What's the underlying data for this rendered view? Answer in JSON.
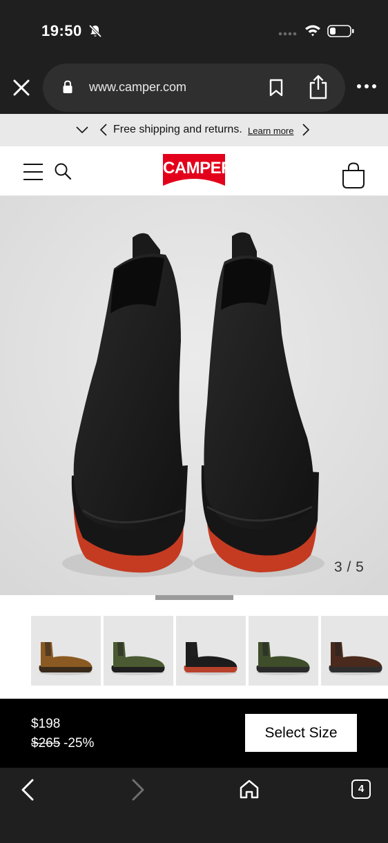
{
  "status_bar": {
    "time": "19:50",
    "icons": [
      "bell-muted-icon",
      "signal-icon",
      "wifi-icon",
      "battery-icon"
    ]
  },
  "browser": {
    "url": "www.camper.com",
    "icons": [
      "close-icon",
      "lock-icon",
      "bookmark-icon",
      "share-icon",
      "more-icon"
    ],
    "tab_count": "4"
  },
  "promo": {
    "text": "Free shipping and returns.",
    "link": "Learn more"
  },
  "header": {
    "logo": "CAMPER",
    "brand_color": "#e3001b"
  },
  "gallery": {
    "counter": "3 / 5",
    "current_index": 3,
    "total": 5,
    "thumbnails": [
      {
        "name": "boot-brown",
        "upper": "#8a5a22",
        "sole": "#3a2a1a"
      },
      {
        "name": "boot-green-black",
        "upper": "#4b5a32",
        "sole": "#1e1e1e"
      },
      {
        "name": "boot-black-red",
        "upper": "#1c1c1c",
        "sole": "#b8412b"
      },
      {
        "name": "boot-olive",
        "upper": "#3f4d2a",
        "sole": "#2a2a2a"
      },
      {
        "name": "boot-dark-brown",
        "upper": "#4a2a1c",
        "sole": "#2e2e2e"
      }
    ]
  },
  "purchase": {
    "price": "$198",
    "old_price": "$265",
    "discount": "-25%",
    "select_size_label": "Select Size"
  }
}
